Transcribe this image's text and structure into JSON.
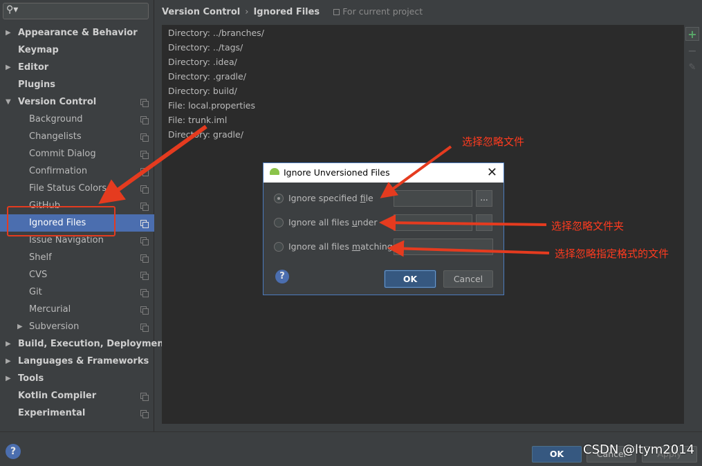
{
  "sidebar": {
    "search_placeholder": "",
    "items": [
      {
        "label": "Appearance & Behavior",
        "bold": true,
        "arrow": "▶",
        "copy": false
      },
      {
        "label": "Keymap",
        "bold": true,
        "arrow": "",
        "copy": false
      },
      {
        "label": "Editor",
        "bold": true,
        "arrow": "▶",
        "copy": false
      },
      {
        "label": "Plugins",
        "bold": true,
        "arrow": "",
        "copy": false
      },
      {
        "label": "Version Control",
        "bold": true,
        "arrow": "▼",
        "copy": true
      },
      {
        "label": "Background",
        "child": true,
        "copy": true
      },
      {
        "label": "Changelists",
        "child": true,
        "copy": true
      },
      {
        "label": "Commit Dialog",
        "child": true,
        "copy": true
      },
      {
        "label": "Confirmation",
        "child": true,
        "copy": true
      },
      {
        "label": "File Status Colors",
        "child": true,
        "copy": true
      },
      {
        "label": "GitHub",
        "child": true,
        "copy": true
      },
      {
        "label": "Ignored Files",
        "child": true,
        "copy": true,
        "selected": true
      },
      {
        "label": "Issue Navigation",
        "child": true,
        "copy": true
      },
      {
        "label": "Shelf",
        "child": true,
        "copy": true
      },
      {
        "label": "CVS",
        "child": true,
        "copy": true
      },
      {
        "label": "Git",
        "child": true,
        "copy": true
      },
      {
        "label": "Mercurial",
        "child": true,
        "copy": true
      },
      {
        "label": "Subversion",
        "child": true,
        "copy": true,
        "arrow": "▶"
      },
      {
        "label": "Build, Execution, Deployment",
        "bold": true,
        "arrow": "▶",
        "copy": false
      },
      {
        "label": "Languages & Frameworks",
        "bold": true,
        "arrow": "▶",
        "copy": false
      },
      {
        "label": "Tools",
        "bold": true,
        "arrow": "▶",
        "copy": false
      },
      {
        "label": "Kotlin Compiler",
        "bold": true,
        "arrow": "",
        "copy": true
      },
      {
        "label": "Experimental",
        "bold": true,
        "arrow": "",
        "copy": true
      }
    ]
  },
  "header": {
    "crumb1": "Version Control",
    "separator": "›",
    "crumb2": "Ignored Files",
    "project_note": "For current project"
  },
  "ignored_list": [
    "Directory: ../branches/",
    "Directory: ../tags/",
    "Directory: .idea/",
    "Directory: .gradle/",
    "Directory: build/",
    "File: local.properties",
    "File: trunk.iml",
    "Directory: gradle/"
  ],
  "toolbar": {
    "add": "+",
    "remove": "−",
    "edit": "✎"
  },
  "dialog": {
    "title": "Ignore Unversioned Files",
    "close": "✕",
    "options": [
      {
        "pre": "Ignore specified ",
        "mnemonic": "f",
        "post": "ile",
        "selected": true
      },
      {
        "pre": "Ignore all files ",
        "mnemonic": "u",
        "post": "nder",
        "selected": false
      },
      {
        "pre": "Ignore all files ",
        "mnemonic": "m",
        "post": "atching",
        "selected": false
      }
    ],
    "browse": "...",
    "help": "?",
    "ok": "OK",
    "cancel": "Cancel"
  },
  "bottom": {
    "help": "?",
    "ok": "OK",
    "cancel": "Cancel",
    "apply": "Apply",
    "watermark": "CSDN @ltym2014"
  },
  "annotations": {
    "note1": "选择忽略文件",
    "note2": "选择忽略文件夹",
    "note3": "选择忽略指定格式的文件",
    "color": "#e53b1f"
  },
  "colors": {
    "accent": "#4b6eaf",
    "ok_button": "#365880",
    "add_icon": "#59a869"
  }
}
